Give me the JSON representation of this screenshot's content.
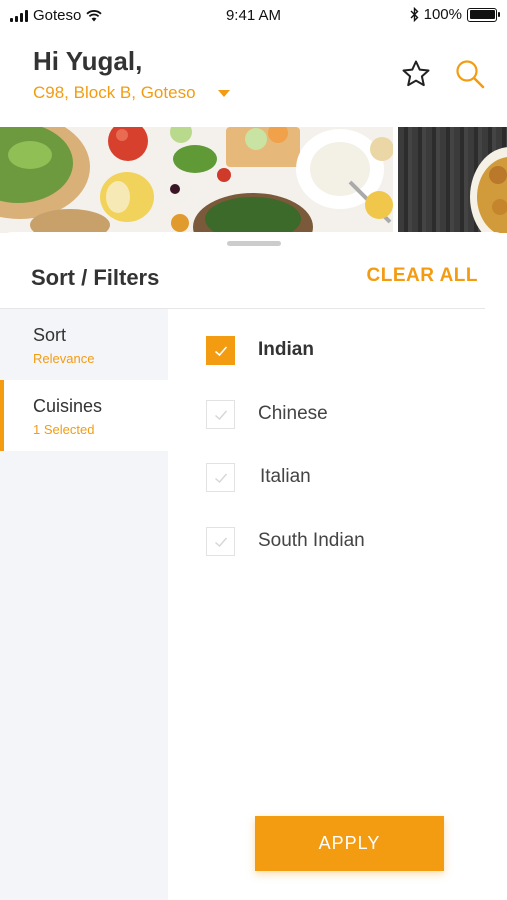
{
  "status_bar": {
    "carrier": "Goteso",
    "time": "9:41 AM",
    "battery": "100%"
  },
  "header": {
    "greeting": "Hi Yugal,",
    "address": "C98, Block B, Goteso"
  },
  "filters": {
    "title": "Sort / Filters",
    "clear_all": "CLEAR ALL",
    "sections": [
      {
        "label": "Sort",
        "sub": "Relevance"
      },
      {
        "label": "Cuisines",
        "sub": "1 Selected"
      }
    ],
    "options": [
      {
        "label": "Indian",
        "checked": true
      },
      {
        "label": "Chinese",
        "checked": false
      },
      {
        "label": "Italian",
        "checked": false
      },
      {
        "label": "South Indian",
        "checked": false
      }
    ],
    "apply": "APPLY"
  },
  "colors": {
    "accent": "#f39c12",
    "sidebar_bg": "#f4f5f8"
  }
}
